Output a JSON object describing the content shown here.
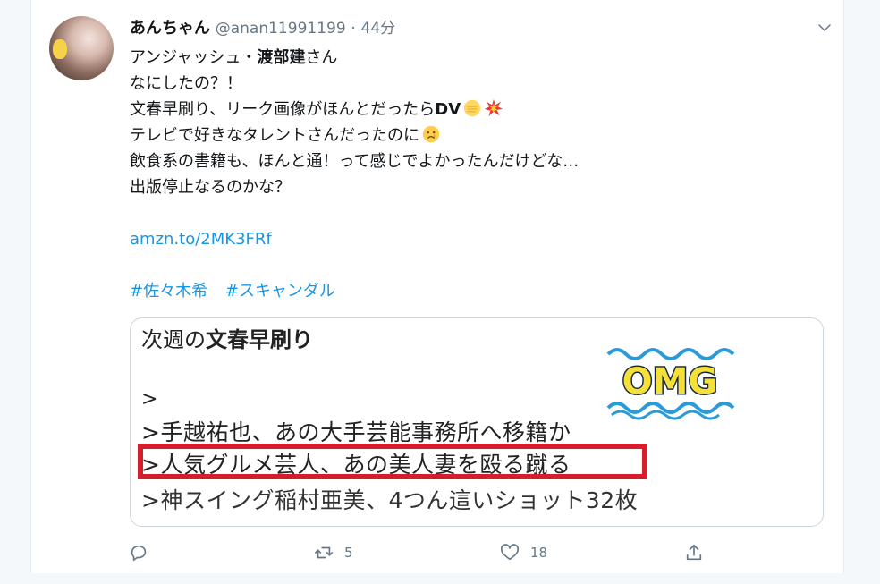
{
  "tweet": {
    "display_name": "あんちゃん",
    "handle": "@anan11991199",
    "separator": "·",
    "time": "44分",
    "lines": [
      {
        "pre": "アンジャッシュ・",
        "bold": "渡部建",
        "post": "さん"
      },
      {
        "pre": "なにしたの？！",
        "bold": "",
        "post": ""
      },
      {
        "pre": "文春早刷り、リーク画像がほんとだったら",
        "bold": "DV",
        "post": ""
      },
      {
        "pre": "テレビで好きなタレントさんだったのに",
        "bold": "",
        "post": ""
      },
      {
        "pre": "飲食系の書籍も、ほんと通！って感じでよかったんだけどな…",
        "bold": "",
        "post": ""
      },
      {
        "pre": "出版停止なるのかな？",
        "bold": "",
        "post": ""
      }
    ],
    "link": "amzn.to/2MK3FRf",
    "hashtags": [
      "#佐々木希",
      "#スキャンダル"
    ],
    "emojis": {
      "fist": "oncoming-fist-emoji",
      "collision": "collision-emoji",
      "crying": "crying-face-emoji"
    }
  },
  "card": {
    "line1_pre": "次週の",
    "line1_bold": "文春早刷り",
    "line2": ">",
    "line3": ">手越祐也、あの大手芸能事務所へ移籍か",
    "line4": ">人気グルメ芸人、あの美人妻を殴る蹴る",
    "line5": ">神スイング稲村亜美、4つん這いショット32枚",
    "sticker_text": "OMG",
    "highlight_color": "#d21f2b"
  },
  "actions": {
    "reply_count": "",
    "retweet_count": "5",
    "like_count": "18"
  },
  "colors": {
    "link": "#1b95e0",
    "muted": "#657786",
    "border": "#ccd6dd"
  }
}
